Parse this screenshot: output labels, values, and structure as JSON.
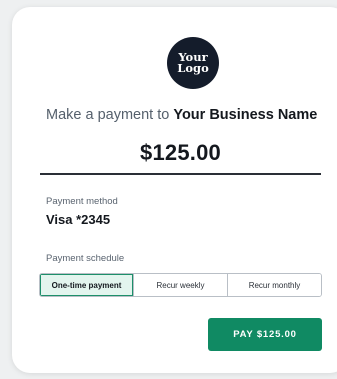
{
  "logo": {
    "text": "Your\nLogo"
  },
  "header": {
    "prefix": "Make a payment to",
    "business_name": "Your Business Name"
  },
  "amount": "$125.00",
  "payment_method": {
    "label": "Payment method",
    "value": "Visa *2345"
  },
  "payment_schedule": {
    "label": "Payment schedule",
    "options": [
      "One-time payment",
      "Recur weekly",
      "Recur monthly"
    ],
    "selected": "One-time payment"
  },
  "pay_button": {
    "label": "PAY $125.00"
  },
  "colors": {
    "accent": "#108a63",
    "logo_bg": "#141c2b",
    "selected_bg": "#e3f5ee"
  }
}
